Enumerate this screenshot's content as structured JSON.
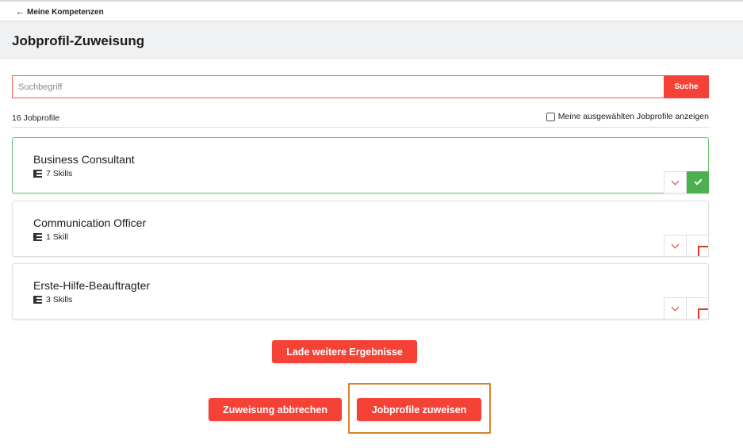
{
  "nav": {
    "back_label": "Meine Kompetenzen"
  },
  "header": {
    "title": "Jobprofil-Zuweisung"
  },
  "search": {
    "placeholder": "Suchbegriff",
    "value": "",
    "button_label": "Suche"
  },
  "results": {
    "count_label": "16 Jobprofile",
    "filter_label": "Meine ausgewählten Jobprofile anzeigen",
    "filter_checked": false
  },
  "profiles": [
    {
      "title": "Business Consultant",
      "skills": "7 Skills",
      "selected": true
    },
    {
      "title": "Communication Officer",
      "skills": "1 Skill",
      "selected": false
    },
    {
      "title": "Erste-Hilfe-Beauftragter",
      "skills": "3 Skills",
      "selected": false
    }
  ],
  "actions": {
    "load_more": "Lade weitere Ergebnisse",
    "cancel": "Zuweisung abbrechen",
    "assign": "Jobprofile zuweisen"
  },
  "colors": {
    "accent": "#f44336",
    "selected": "#4caf50",
    "highlight": "#d9822b",
    "header_band": "#f0f1f3"
  }
}
